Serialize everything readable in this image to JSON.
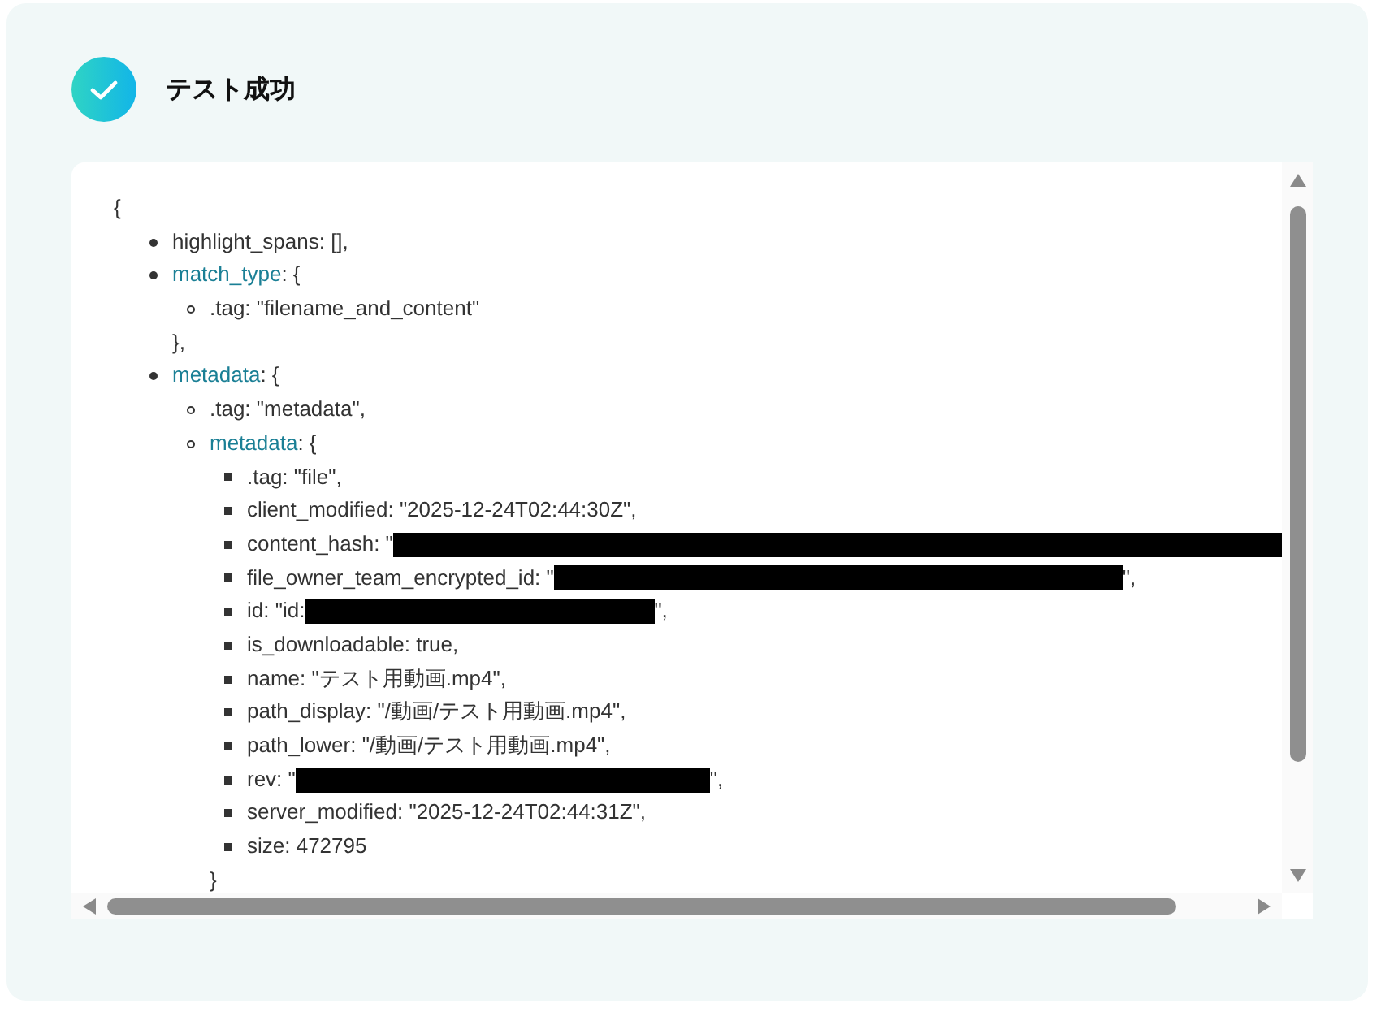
{
  "header": {
    "kind": "success",
    "title": "テスト成功"
  },
  "output": {
    "open": "{",
    "items": [
      {
        "kind": "value",
        "text": "highlight_spans: [],"
      },
      {
        "kind": "object",
        "key": "match_type",
        "rest": ": {",
        "close": "},",
        "children": [
          {
            "kind": "value",
            "text": ".tag: \"filename_and_content\""
          }
        ]
      },
      {
        "kind": "object",
        "key": "metadata",
        "rest": ": {",
        "children": [
          {
            "kind": "value",
            "text": ".tag: \"metadata\","
          },
          {
            "kind": "object",
            "key": "metadata",
            "rest": ": {",
            "close": "}",
            "children": [
              {
                "kind": "value",
                "text": ".tag: \"file\","
              },
              {
                "kind": "value",
                "text": "client_modified: \"2025-12-24T02:44:30Z\","
              },
              {
                "kind": "redacted",
                "text": "content_hash: \""
              },
              {
                "kind": "redacted",
                "text": "file_owner_team_encrypted_id: \"",
                "after": "\","
              },
              {
                "kind": "redacted",
                "text": "id: \"id:",
                "after": "\","
              },
              {
                "kind": "value",
                "text": "is_downloadable: true,"
              },
              {
                "kind": "value",
                "text": "name: \"テスト用動画.mp4\","
              },
              {
                "kind": "value",
                "text": "path_display: \"/動画/テスト用動画.mp4\","
              },
              {
                "kind": "value",
                "text": "path_lower: \"/動画/テスト用動画.mp4\","
              },
              {
                "kind": "redacted",
                "text": "rev: \"",
                "after": "\","
              },
              {
                "kind": "value",
                "text": "server_modified: \"2025-12-24T02:44:31Z\","
              },
              {
                "kind": "value",
                "text": "size: 472795"
              }
            ]
          }
        ]
      }
    ]
  }
}
